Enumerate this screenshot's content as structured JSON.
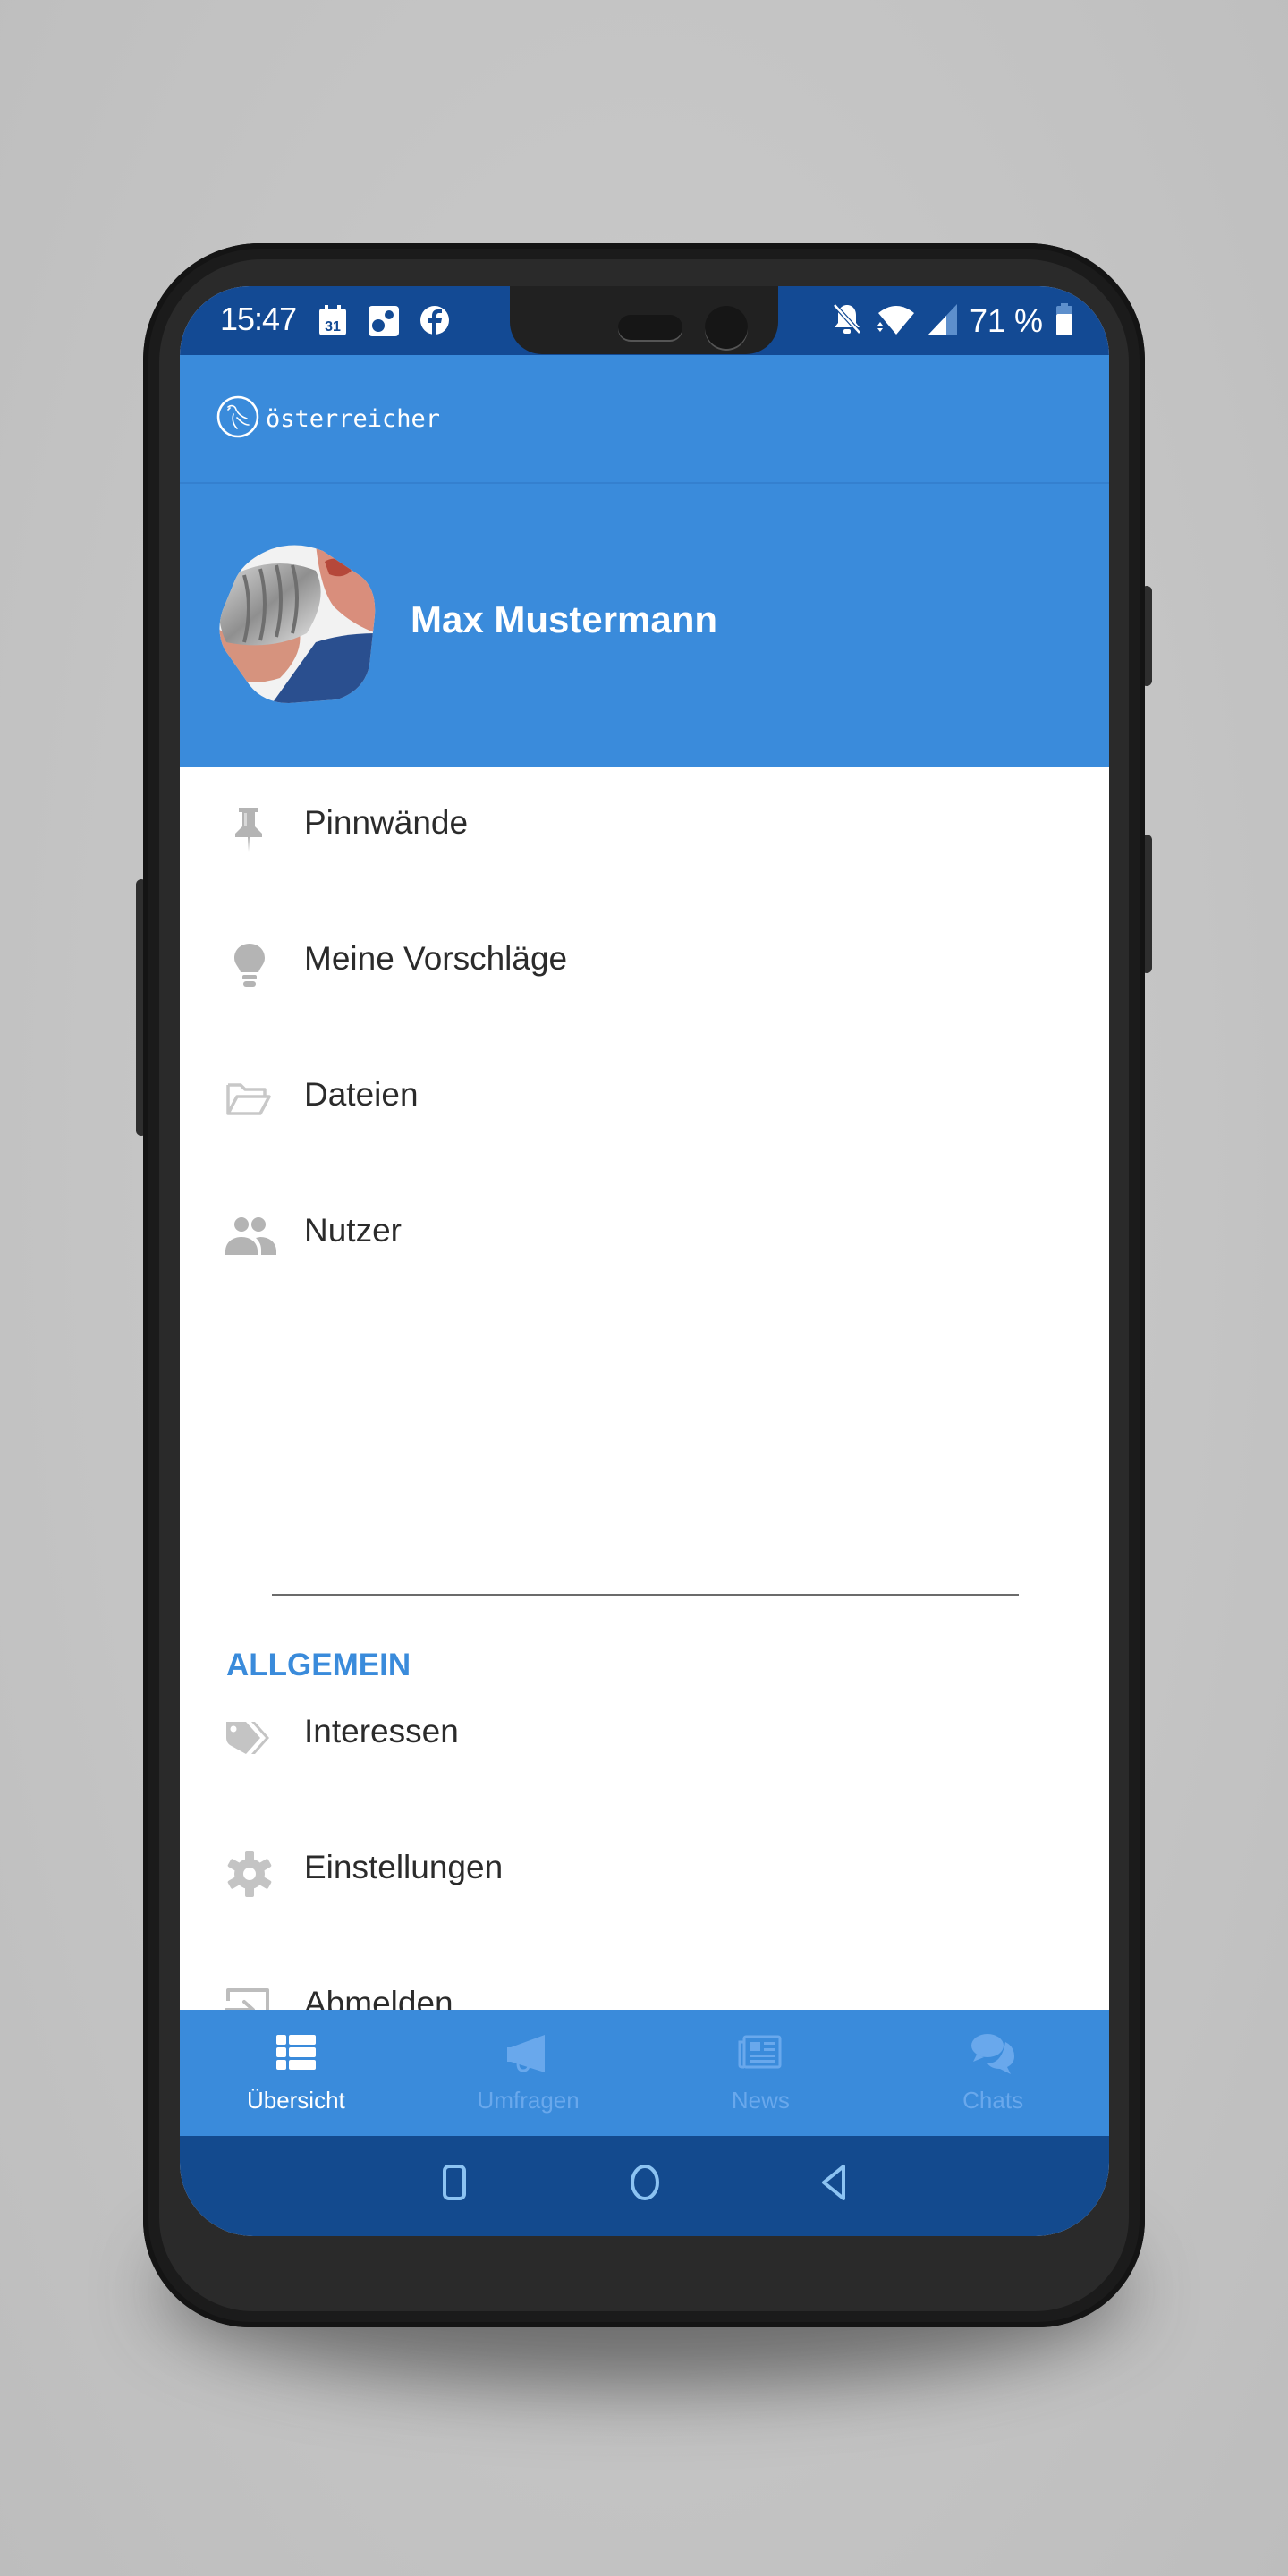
{
  "status_bar": {
    "time": "15:47",
    "calendar_day": "31",
    "left_icons": [
      "calendar-icon",
      "dice-app-icon",
      "facebook-icon"
    ],
    "right_icons": [
      "bell-off-icon",
      "wifi-icon",
      "signal-icon",
      "battery-icon"
    ],
    "battery_percent": "71 %"
  },
  "app_bar": {
    "logo_text": "österreicher"
  },
  "profile": {
    "name": "Max Mustermann"
  },
  "menu": {
    "items": [
      {
        "label": "Pinnwände",
        "icon": "pushpin-icon"
      },
      {
        "label": "Meine Vorschläge",
        "icon": "lightbulb-icon"
      },
      {
        "label": "Dateien",
        "icon": "folder-open-icon"
      },
      {
        "label": "Nutzer",
        "icon": "users-icon"
      }
    ],
    "section_title": "ALLGEMEIN",
    "general_items": [
      {
        "label": "Interessen",
        "icon": "tags-icon"
      },
      {
        "label": "Einstellungen",
        "icon": "gear-icon"
      },
      {
        "label": "Abmelden",
        "icon": "sign-in-icon"
      }
    ]
  },
  "tab_bar": {
    "tabs": [
      {
        "label": "Übersicht",
        "icon": "list-icon",
        "active": true
      },
      {
        "label": "Umfragen",
        "icon": "megaphone-icon",
        "active": false
      },
      {
        "label": "News",
        "icon": "newspaper-icon",
        "active": false
      },
      {
        "label": "Chats",
        "icon": "chat-bubbles-icon",
        "active": false
      }
    ]
  },
  "system_nav": {
    "buttons": [
      "recents",
      "home",
      "back"
    ]
  },
  "colors": {
    "primary": "#3a8bdb",
    "status_bar": "#134a94",
    "system_nav": "#134a8e",
    "icon_gray": "#bdbdbd",
    "text": "#2b2b2b",
    "tab_inactive": "#69a8ec"
  }
}
